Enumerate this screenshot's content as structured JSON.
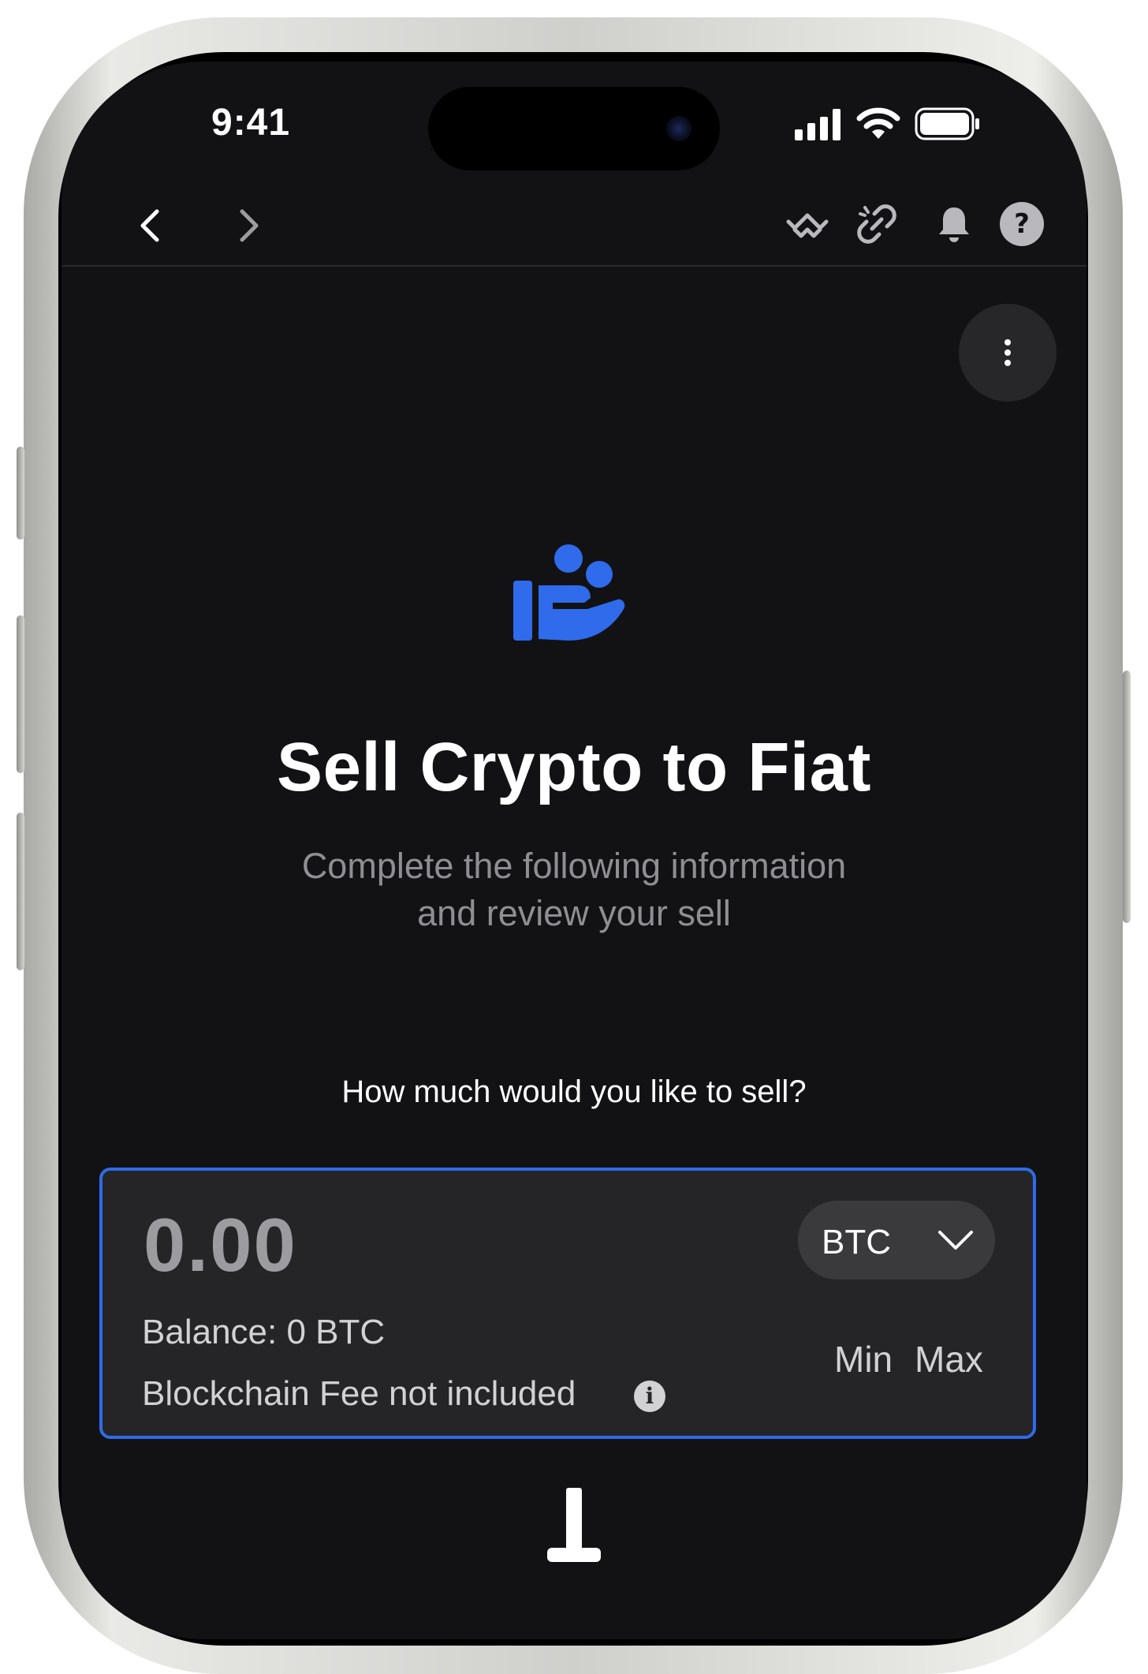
{
  "status_bar": {
    "time": "9:41",
    "icons": [
      "signal-icon",
      "wifi-icon",
      "battery-icon"
    ]
  },
  "navbar": {
    "icons": [
      "back-icon",
      "forward-icon",
      "walletconnect-icon",
      "link-icon",
      "bell-icon",
      "help-icon"
    ]
  },
  "page": {
    "title": "Sell Crypto to Fiat",
    "subtitle_line1": "Complete the following information",
    "subtitle_line2": "and review your sell",
    "question": "How much would you like to sell?"
  },
  "amount_card": {
    "value": "0.00",
    "currency": "BTC",
    "balance": "Balance: 0 BTC",
    "fee_note": "Blockchain Fee not included",
    "min_label": "Min",
    "max_label": "Max"
  },
  "colors": {
    "accent": "#2f6bea",
    "background": "#121214",
    "card": "#252527"
  }
}
